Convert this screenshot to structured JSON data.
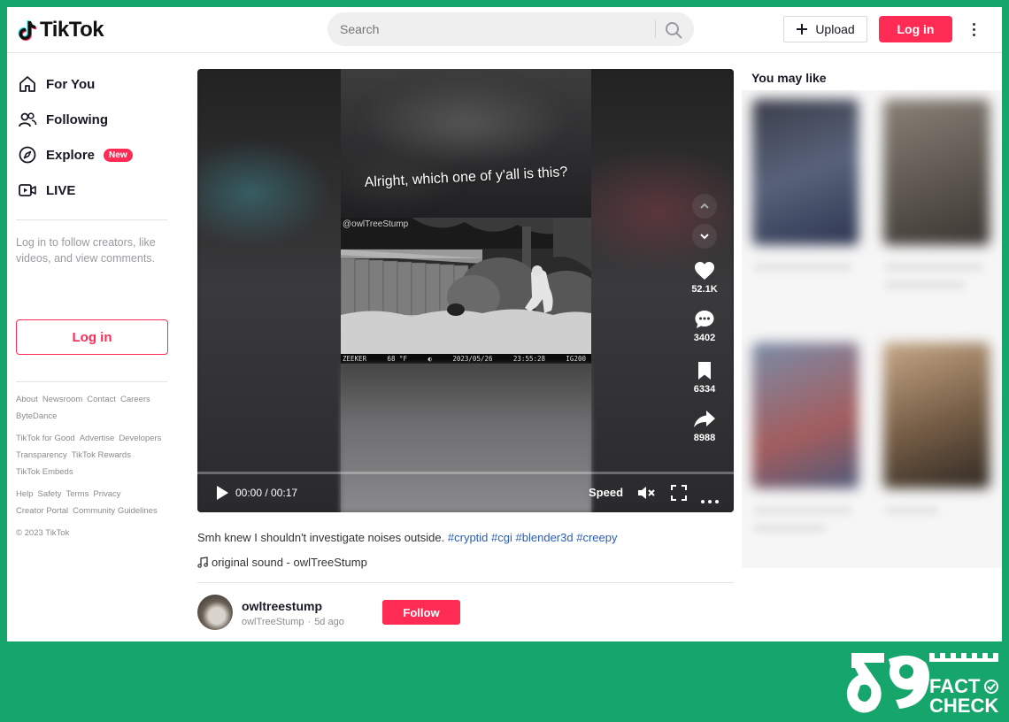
{
  "header": {
    "logo_text": "TikTok",
    "search_placeholder": "Search",
    "upload_label": "Upload",
    "login_label": "Log in"
  },
  "sidebar": {
    "nav": [
      {
        "label": "For You",
        "icon": "home-icon"
      },
      {
        "label": "Following",
        "icon": "people-icon"
      },
      {
        "label": "Explore",
        "icon": "compass-icon",
        "badge": "New"
      },
      {
        "label": "LIVE",
        "icon": "live-icon"
      }
    ],
    "login_hint": "Log in to follow creators, like videos, and view comments.",
    "login_button": "Log in",
    "footer_rows": [
      [
        "About",
        "Newsroom",
        "Contact",
        "Careers"
      ],
      [
        "ByteDance"
      ],
      [
        "TikTok for Good",
        "Advertise",
        "Developers"
      ],
      [
        "Transparency",
        "TikTok Rewards"
      ],
      [
        "TikTok Embeds"
      ],
      [
        "Help",
        "Safety",
        "Terms",
        "Privacy"
      ],
      [
        "Creator Portal",
        "Community Guidelines"
      ],
      [
        "© 2023 TikTok"
      ]
    ]
  },
  "video": {
    "overlay_caption": "Alright, which one of y'all is this?",
    "watermark": "@owlTreeStump",
    "cam_stamp": {
      "brand": "ZEEKER",
      "temp": "68 °F",
      "moon": "◐",
      "date": "2023/05/26",
      "time": "23:55:28",
      "code": "IG200"
    },
    "actions": {
      "likes": "52.1K",
      "comments": "3402",
      "saves": "6334",
      "shares": "8988"
    },
    "time": "00:00 / 00:17",
    "speed_label": "Speed",
    "progress": 0.0
  },
  "post": {
    "description": "Smh knew I shouldn't investigate noises outside.",
    "hashtags": [
      "#cryptid",
      "#cgi",
      "#blender3d",
      "#creepy"
    ],
    "sound": "original sound - owlTreeStump",
    "author_handle": "owltreestump",
    "author_name": "owlTreeStump",
    "posted": "5d ago",
    "follow_label": "Follow"
  },
  "right": {
    "title": "You may like"
  },
  "badge": {
    "line1": "FACT",
    "line2": "CHECK"
  },
  "colors": {
    "brand": "#fe2c55",
    "frame": "#16a56b",
    "hashtag": "#2b5db9"
  }
}
